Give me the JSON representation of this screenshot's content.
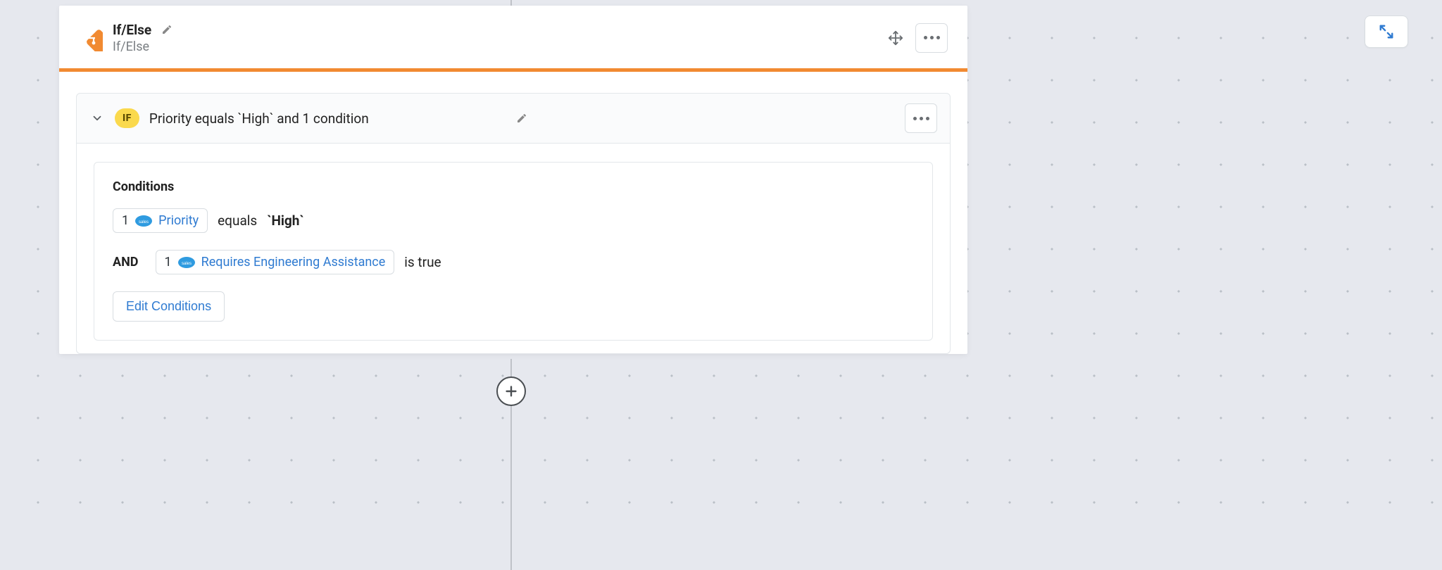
{
  "node": {
    "title": "If/Else",
    "subtitle": "If/Else",
    "accentColor": "#f18a31"
  },
  "branch": {
    "pill": "IF",
    "summary": "Priority equals `High` and 1 condition"
  },
  "conditions": {
    "heading": "Conditions",
    "rows": [
      {
        "joiner": "",
        "chipIndex": "1",
        "field": "Priority",
        "operator": "equals",
        "value": "`High`",
        "valueBold": true
      },
      {
        "joiner": "AND",
        "chipIndex": "1",
        "field": "Requires Engineering Assistance",
        "operator": "is true",
        "value": "",
        "valueBold": false
      }
    ],
    "editLabel": "Edit Conditions"
  }
}
